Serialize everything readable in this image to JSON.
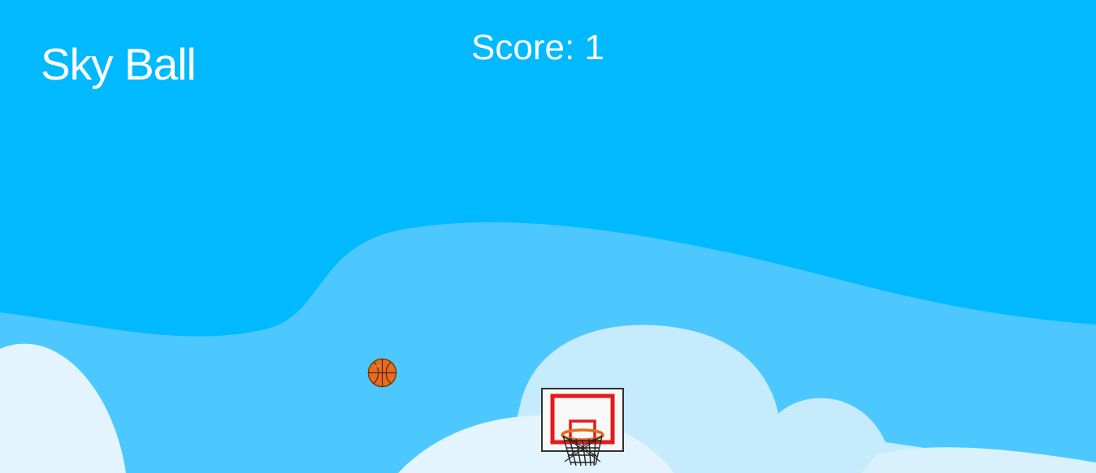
{
  "game": {
    "title": "Sky Ball",
    "score_label": "Score:",
    "score": 1
  },
  "sprites": {
    "ball": "basketball-icon",
    "hoop": "basketball-hoop-icon"
  },
  "colors": {
    "sky": "#00b9ff",
    "hills_back": "#4cc8ff",
    "cloud_back": "#c6ebfd",
    "cloud_front": "#e3f4fe",
    "text": "#ffffff",
    "ball": "#e66d1e",
    "backboard_border": "#e31b1b"
  }
}
